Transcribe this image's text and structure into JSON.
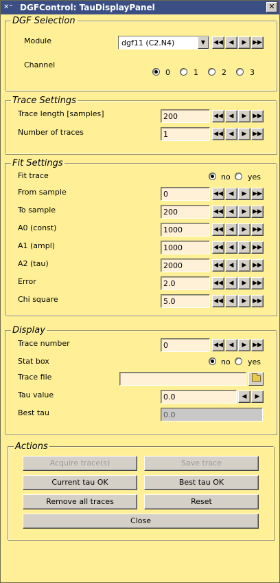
{
  "window": {
    "title": "DGFControl: TauDisplayPanel",
    "close_label": "✕",
    "sys_icon": "✕⁼"
  },
  "dgf_selection": {
    "legend": "DGF Selection",
    "module_label": "Module",
    "module_value": "dgf11 (C2.N4)",
    "channel_label": "Channel",
    "channel_options": [
      "0",
      "1",
      "2",
      "3"
    ],
    "channel_selected": "0"
  },
  "trace_settings": {
    "legend": "Trace Settings",
    "trace_length_label": "Trace length [samples]",
    "trace_length_value": "200",
    "num_traces_label": "Number of traces",
    "num_traces_value": "1"
  },
  "fit_settings": {
    "legend": "Fit Settings",
    "fit_trace_label": "Fit trace",
    "fit_trace_no": "no",
    "fit_trace_yes": "yes",
    "fit_trace_selected": "no",
    "from_sample_label": "From sample",
    "from_sample_value": "0",
    "to_sample_label": "To sample",
    "to_sample_value": "200",
    "a0_label": "A0 (const)",
    "a0_value": "1000",
    "a1_label": "A1 (ampl)",
    "a1_value": "1000",
    "a2_label": "A2 (tau)",
    "a2_value": "2000",
    "error_label": "Error",
    "error_value": "2.0",
    "chi_label": "Chi square",
    "chi_value": "5.0"
  },
  "display": {
    "legend": "Display",
    "trace_number_label": "Trace number",
    "trace_number_value": "0",
    "stat_box_label": "Stat box",
    "stat_box_no": "no",
    "stat_box_yes": "yes",
    "stat_box_selected": "no",
    "trace_file_label": "Trace file",
    "trace_file_value": "",
    "tau_value_label": "Tau value",
    "tau_value_value": "0.0",
    "best_tau_label": "Best tau",
    "best_tau_value": "0.0"
  },
  "actions": {
    "legend": "Actions",
    "acquire_label": "Acquire trace(s)",
    "save_label": "Save trace",
    "current_tau_label": "Current tau OK",
    "best_tau_label": "Best tau OK",
    "remove_label": "Remove all traces",
    "reset_label": "Reset",
    "close_label": "Close"
  },
  "nav_glyphs": {
    "first": "◀◀",
    "prev": "◀",
    "next": "▶",
    "last": "▶▶",
    "down": "▼"
  },
  "colors": {
    "background": "#fff098",
    "titlebar": "#3b4f84",
    "entry": "#fff0d8",
    "button": "#d4d0c8"
  }
}
